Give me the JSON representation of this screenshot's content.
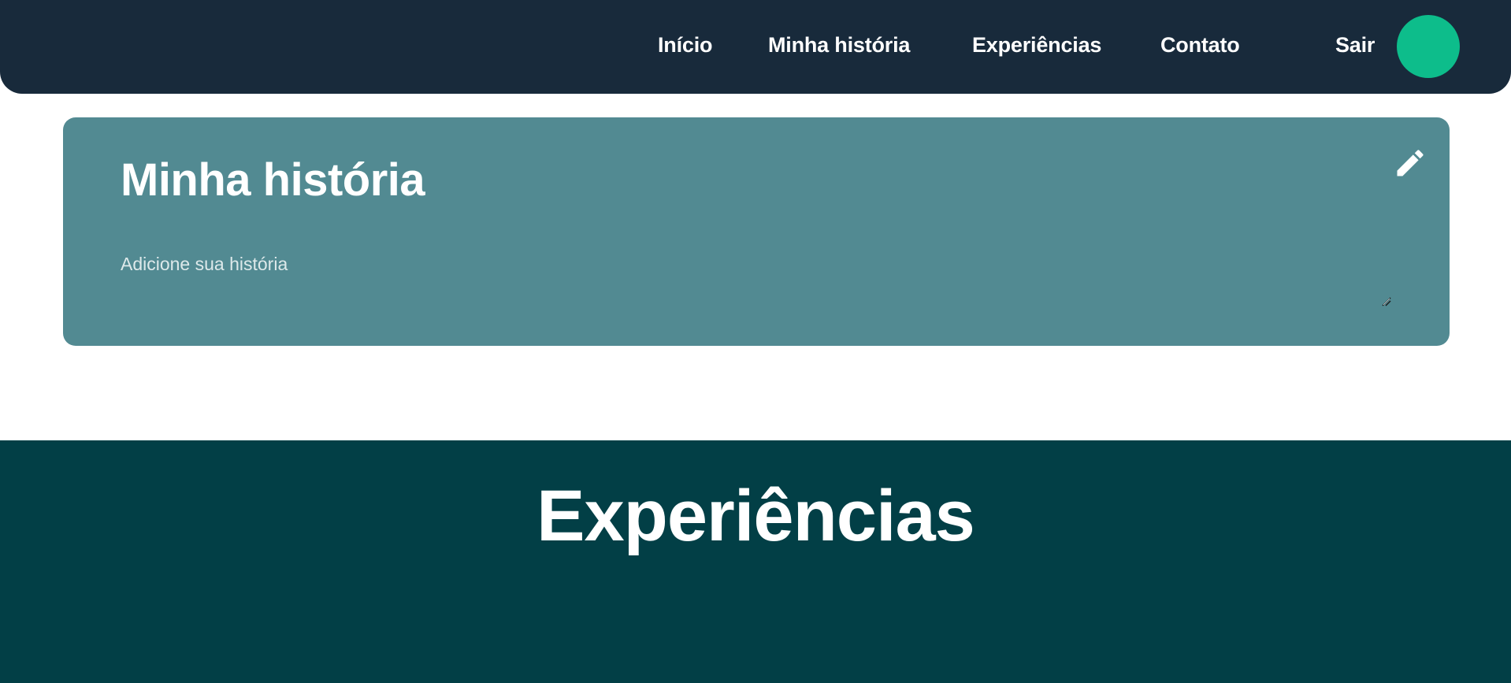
{
  "nav": {
    "inicio": "Início",
    "minha_historia": "Minha história",
    "experiencias": "Experiências",
    "contato": "Contato",
    "sair": "Sair"
  },
  "story": {
    "title": "Minha história",
    "placeholder": "Adicione sua história",
    "value": ""
  },
  "experiences": {
    "title": "Experiências"
  },
  "colors": {
    "topbar": "#182a3b",
    "avatar": "#0dbd8b",
    "story_card": "#528a92",
    "experiences_bg": "#023f46"
  },
  "icons": {
    "edit": "pencil-icon",
    "resize": "resize-grip-icon"
  }
}
